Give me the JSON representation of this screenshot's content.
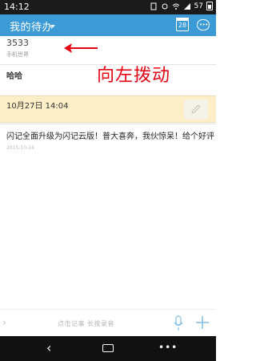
{
  "status_bar": {
    "time": "14:12",
    "battery": "57",
    "icons": [
      "sim-card-icon",
      "notification-icon",
      "wifi-icon",
      "signal-icon",
      "battery-icon"
    ]
  },
  "app_bar": {
    "title": "我的待办",
    "calendar_day": "28",
    "color": "#3c9ad7"
  },
  "list": {
    "items": [
      {
        "title": "3533",
        "subtitle": "手机世界"
      },
      {
        "title": "哈哈",
        "subtitle": ""
      }
    ],
    "highlighted": {
      "date_text": "10月27日 14:04"
    },
    "note": {
      "text": "闪记全面升级为闪记云版！普大喜奔，我伙惊呆！给个好评",
      "date": "2015-10-24"
    }
  },
  "annotation": {
    "text": "向左拨动",
    "color": "#e60012"
  },
  "bottom_bar": {
    "hint": "点击记事  长按录音"
  },
  "nav_bar": {
    "back": "‹",
    "menu": "•••"
  }
}
